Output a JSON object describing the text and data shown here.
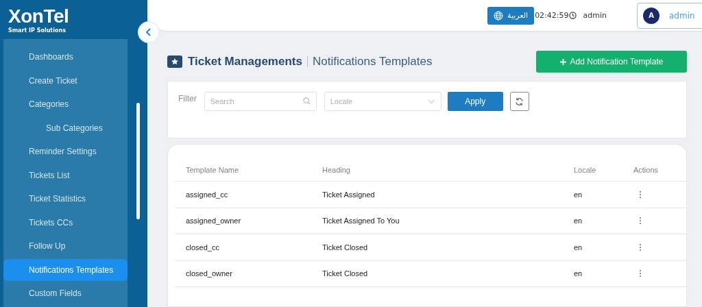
{
  "logo": {
    "name": "XonTel",
    "tagline": "Smart IP Solutions"
  },
  "sidebar": {
    "items": [
      {
        "label": "Dashboards",
        "selected": false
      },
      {
        "label": "Create Ticket",
        "selected": false
      },
      {
        "label": "Categories",
        "selected": false,
        "children": [
          {
            "label": "Sub Categories",
            "selected": false
          }
        ]
      },
      {
        "label": "Reminder Settings",
        "selected": false
      },
      {
        "label": "Tickets List",
        "selected": false
      },
      {
        "label": "Ticket Statistics",
        "selected": false
      },
      {
        "label": "Tickets CCs",
        "selected": false
      },
      {
        "label": "Follow Up",
        "selected": false
      },
      {
        "label": "Notifications Templates",
        "selected": true
      },
      {
        "label": "Custom Fields",
        "selected": false
      }
    ]
  },
  "header": {
    "language_button": "العربية",
    "time": "02:42:59",
    "username": "admin",
    "user_menu": {
      "avatar": "A",
      "name": "admin"
    }
  },
  "page": {
    "title": "Ticket Managements",
    "subtitle": "Notifications Templates",
    "add_button": "Add Notification Template"
  },
  "filter": {
    "label": "Filter",
    "search": {
      "placeholder": "Search"
    },
    "locale": {
      "placeholder": "Locale"
    },
    "apply_button": "Apply"
  },
  "table": {
    "columns": [
      "Template Name",
      "Heading",
      "Locale",
      "Actions"
    ],
    "rows": [
      {
        "name": "assigned_cc",
        "heading": "Ticket Assigned",
        "locale": "en"
      },
      {
        "name": "assigned_owner",
        "heading": "Ticket Assigned To You",
        "locale": "en"
      },
      {
        "name": "closed_cc",
        "heading": "Ticket Closed",
        "locale": "en"
      },
      {
        "name": "closed_owner",
        "heading": "Ticket Closed",
        "locale": "en"
      }
    ]
  }
}
